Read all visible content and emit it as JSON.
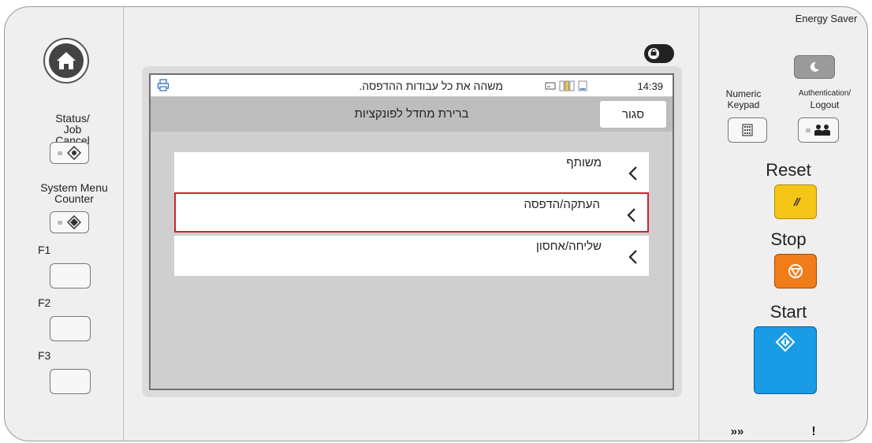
{
  "left_panel": {
    "home_icon": "home-icon",
    "status_job_cancel_line1": "Status/",
    "status_job_cancel_line2": "Job Cancel",
    "system_menu_line1": "System Menu",
    "system_menu_line2": "Counter",
    "f1_label": "F1",
    "f2_label": "F2",
    "f3_label": "F3"
  },
  "screen": {
    "status_message": "משהה את כל עבודות ההדפסה.",
    "clock": "14:39",
    "header_title": "ברירת מחדל לפונקציות",
    "close_label": "סגור",
    "items": [
      {
        "label": "משותף",
        "selected": false
      },
      {
        "label": "העתקה/הדפסה",
        "selected": true
      },
      {
        "label": "שליחה/אחסון",
        "selected": false
      }
    ]
  },
  "right_panel": {
    "energy_saver_label": "Energy Saver",
    "numeric_keypad_line1": "Numeric",
    "numeric_keypad_line2": "Keypad",
    "auth_logout_line1": "Authentication/",
    "auth_logout_line2": "Logout",
    "reset_label": "Reset",
    "stop_label": "Stop",
    "start_label": "Start",
    "reset_color": "#f5c518",
    "stop_color": "#f07c1a",
    "start_color": "#1a9be6",
    "bottom_indicator_1": "»»",
    "bottom_indicator_2": "!"
  }
}
